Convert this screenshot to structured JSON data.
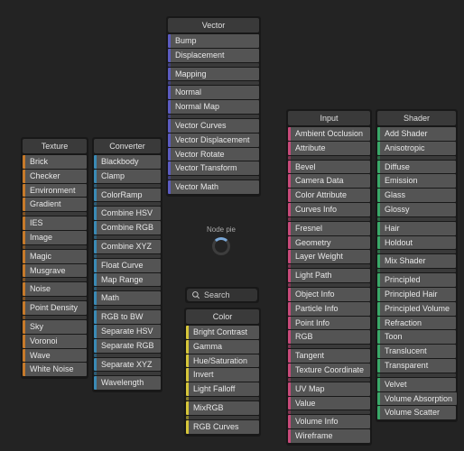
{
  "center_label": "Node pie",
  "search_label": "Search",
  "panels": {
    "texture": {
      "title": "Texture",
      "items": [
        "Brick",
        "Checker",
        "Environment",
        "Gradient",
        "",
        "IES",
        "Image",
        "",
        "Magic",
        "Musgrave",
        "",
        "Noise",
        "",
        "Point Density",
        "",
        "Sky",
        "Voronoi",
        "Wave",
        "White Noise"
      ]
    },
    "converter": {
      "title": "Converter",
      "items": [
        "Blackbody",
        "Clamp",
        "",
        "ColorRamp",
        "",
        "Combine HSV",
        "Combine RGB",
        "",
        "Combine XYZ",
        "",
        "Float Curve",
        "Map Range",
        "",
        "Math",
        "",
        "RGB to BW",
        "Separate HSV",
        "Separate RGB",
        "",
        "Separate XYZ",
        "",
        "Wavelength"
      ]
    },
    "vector": {
      "title": "Vector",
      "items": [
        "Bump",
        "Displacement",
        "",
        "Mapping",
        "",
        "Normal",
        "Normal Map",
        "",
        "Vector Curves",
        "Vector Displacement",
        "Vector Rotate",
        "Vector Transform",
        "",
        "Vector Math"
      ]
    },
    "color": {
      "title": "Color",
      "items": [
        "Bright Contrast",
        "Gamma",
        "Hue/Saturation",
        "Invert",
        "Light Falloff",
        "",
        "MixRGB",
        "",
        "RGB Curves"
      ]
    },
    "input": {
      "title": "Input",
      "items": [
        "Ambient Occlusion",
        "Attribute",
        "",
        "Bevel",
        "Camera Data",
        "Color Attribute",
        "Curves Info",
        "",
        "Fresnel",
        "Geometry",
        "Layer Weight",
        "",
        "Light Path",
        "",
        "Object Info",
        "Particle Info",
        "Point Info",
        "RGB",
        "",
        "Tangent",
        "Texture Coordinate",
        "",
        "UV Map",
        "Value",
        "",
        "Volume Info",
        "Wireframe"
      ]
    },
    "shader": {
      "title": "Shader",
      "items": [
        "Add Shader",
        "Anisotropic",
        "",
        "Diffuse",
        "Emission",
        "Glass",
        "Glossy",
        "",
        "Hair",
        "Holdout",
        "",
        "Mix Shader",
        "",
        "Principled",
        "Principled Hair",
        "Principled Volume",
        "Refraction",
        "Toon",
        "Translucent",
        "Transparent",
        "",
        "Velvet",
        "Volume Absorption",
        "Volume Scatter"
      ]
    }
  }
}
